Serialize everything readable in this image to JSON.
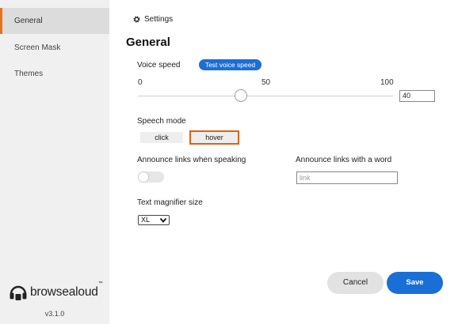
{
  "sidebar": {
    "items": [
      {
        "label": "General"
      },
      {
        "label": "Screen Mask"
      },
      {
        "label": "Themes"
      }
    ],
    "brand": {
      "name": "browsealoud",
      "trademark": "™"
    },
    "version": "v3.1.0"
  },
  "header": {
    "settings_label": "Settings",
    "settings_icon": "gear-icon"
  },
  "main": {
    "title": "General",
    "voice_speed": {
      "label": "Voice speed",
      "test_button": "Test voice speed",
      "ticks": [
        "0",
        "50",
        "100"
      ],
      "value": "40",
      "min": 0,
      "max": 100
    },
    "speech_mode": {
      "label": "Speech mode",
      "options": [
        "click",
        "hover"
      ],
      "selected": "hover"
    },
    "announce_links": {
      "label": "Announce links when speaking",
      "enabled": false
    },
    "announce_word": {
      "label": "Announce links with a word",
      "placeholder": "link"
    },
    "magnifier": {
      "label": "Text magnifier size",
      "selected": "XL"
    },
    "actions": {
      "cancel": "Cancel",
      "save": "Save"
    }
  },
  "colors": {
    "accent": "#1a6fd6",
    "highlight": "#e8731c",
    "sidebar_bg": "#f0f0f0"
  }
}
